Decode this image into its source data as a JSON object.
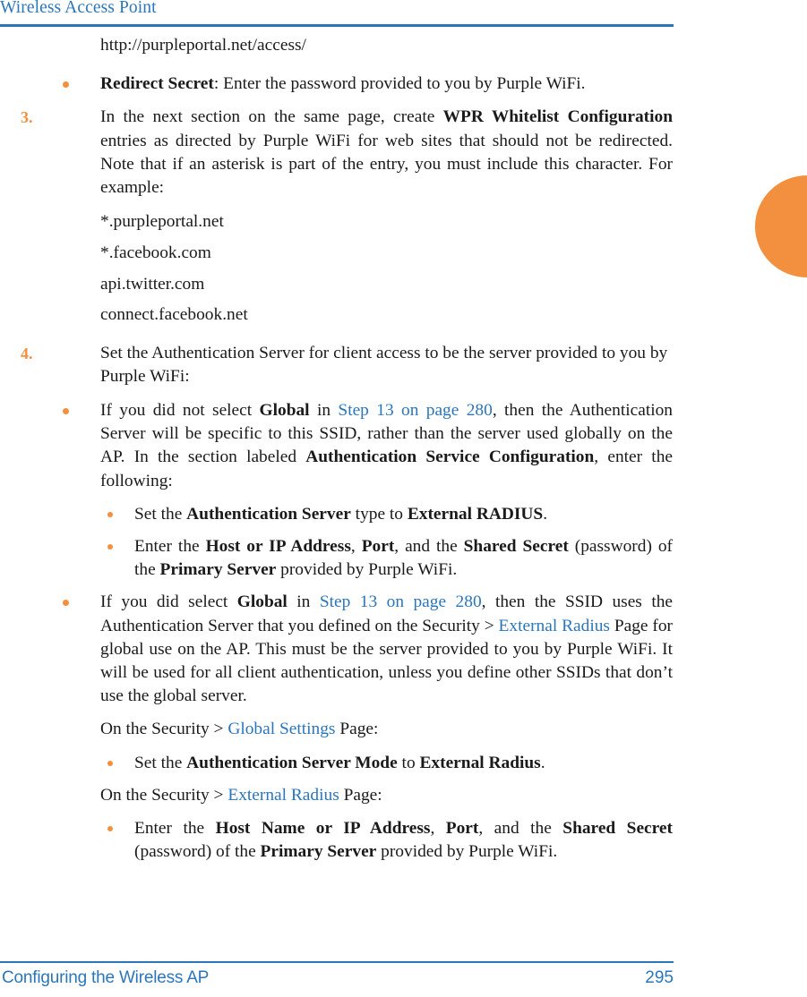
{
  "header": {
    "title": "Wireless Access Point"
  },
  "footer": {
    "section_label": "Configuring the Wireless AP",
    "page_number": "295"
  },
  "colors": {
    "accent_blue": "#2b76bb",
    "accent_orange": "#f3903f",
    "link_blue": "#2b76bb",
    "body_text": "#1a1a1a"
  },
  "content": {
    "url_line": "http://purpleportal.net/access/",
    "redirect_secret_bullet": {
      "bold_lead": "Redirect Secret",
      "rest": ": Enter the password provided to you by Purple WiFi."
    },
    "step3": {
      "number": "3.",
      "part1": "In the next section on the same page, create ",
      "bold1": "WPR Whitelist Configuration",
      "part2": " entries as directed by Purple WiFi for web sites that should not be redirected. Note that if an asterisk is part of the entry, you must include this character. For example:"
    },
    "examples": [
      "*.purpleportal.net",
      "*.facebook.com",
      "api.twitter.com",
      "connect.facebook.net"
    ],
    "step4": {
      "number": "4.",
      "text": "Set the Authentication Server for client access to be the server provided to you by Purple WiFi:"
    },
    "not_global_bullet": {
      "part1": "If you did not select ",
      "bold1": "Global",
      "part2": " in ",
      "link1": "Step 13 on page 280",
      "part3": ", then the Authentication Server will be specific to this SSID, rather than the server used globally on the AP. In the section labeled ",
      "bold2": "Authentication Service Configuration",
      "part4": ", enter the following:"
    },
    "not_global_subbullets": [
      {
        "part1": "Set the ",
        "bold1": "Authentication Server",
        "part2": " type to ",
        "bold2": "External RADIUS",
        "part3": "."
      },
      {
        "part1": "Enter the ",
        "bold1": "Host or IP Address",
        "part2": ", ",
        "bold2": "Port",
        "part3": ", and the ",
        "bold3": "Shared Secret",
        "part4": " (password) of the ",
        "bold4": "Primary Server",
        "part5": " provided by Purple WiFi."
      }
    ],
    "did_global_bullet": {
      "part1": "If you did select ",
      "bold1": "Global",
      "part2": " in ",
      "link1": "Step 13 on page 280",
      "part3": ", then the SSID uses the Authentication Server that you defined on the Security > ",
      "link2": "External Radius",
      "part4": " Page for global use on the AP. This must be the server provided to you by Purple WiFi. It will be used for all client authentication, unless you define other SSIDs that don’t use the global server."
    },
    "global_settings_line": {
      "part1": "On the Security > ",
      "link1": "Global Settings",
      "part2": " Page:"
    },
    "global_settings_bullet": {
      "part1": "Set the ",
      "bold1": "Authentication Server Mode",
      "part2": " to ",
      "bold2": "External Radius",
      "part3": "."
    },
    "external_radius_line": {
      "part1": "On the Security > ",
      "link1": "External Radius",
      "part2": " Page:"
    },
    "external_radius_bullet": {
      "part1": "Enter the ",
      "bold1": "Host Name or IP Address",
      "part2": ", ",
      "bold2": "Port",
      "part3": ", and the ",
      "bold3": "Shared Secret",
      "part4": " (password) of the ",
      "bold4": "Primary Server",
      "part5": " provided by Purple WiFi."
    }
  }
}
